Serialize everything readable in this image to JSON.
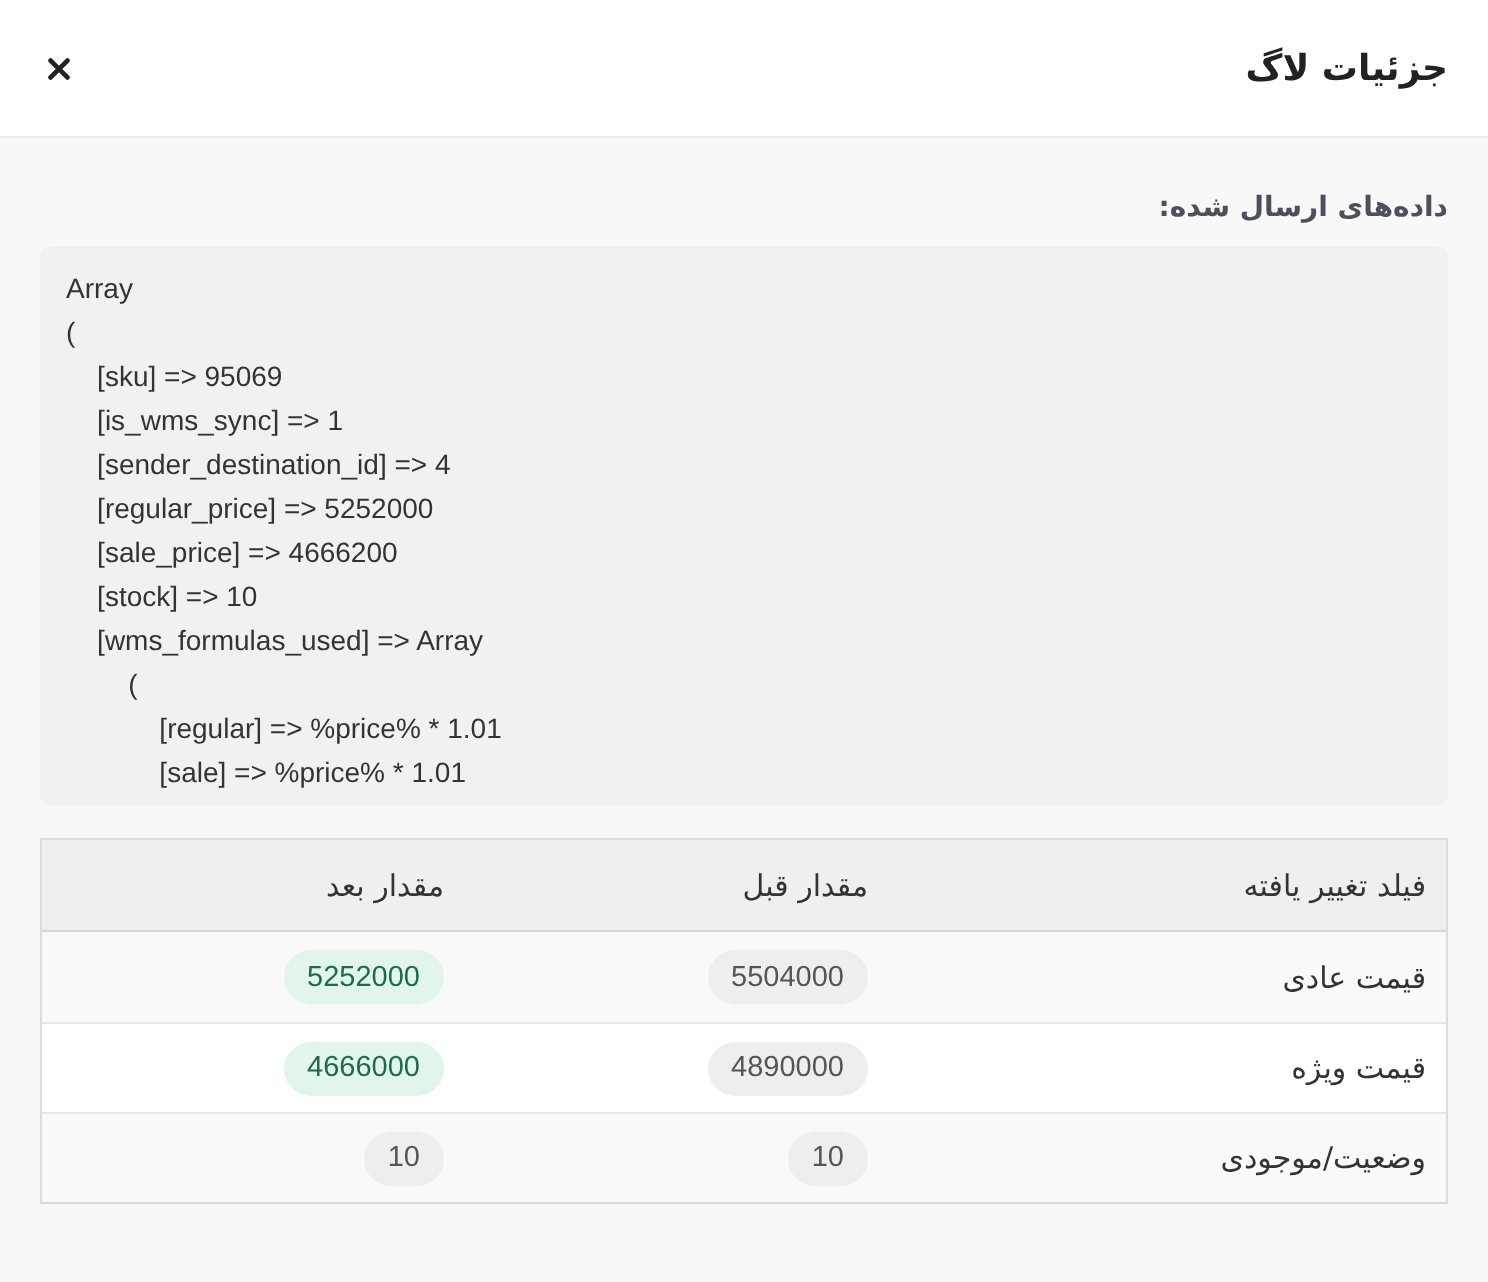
{
  "dialog": {
    "title": "جزئیات لاگ"
  },
  "sent_data": {
    "label": "داده‌های ارسال شده:",
    "text": "Array\n(\n    [sku] => 95069\n    [is_wms_sync] => 1\n    [sender_destination_id] => 4\n    [regular_price] => 5252000\n    [sale_price] => 4666200\n    [stock] => 10\n    [wms_formulas_used] => Array\n        (\n            [regular] => %price% * 1.01\n            [sale] => %price% * 1.01"
  },
  "changes_table": {
    "columns": [
      "فیلد تغییر یافته",
      "مقدار قبل",
      "مقدار بعد"
    ],
    "rows": [
      {
        "field": "قیمت عادی",
        "before": "5504000",
        "after": "5252000",
        "changed": true
      },
      {
        "field": "قیمت ویژه",
        "before": "4890000",
        "after": "4666000",
        "changed": true
      },
      {
        "field": "وضعیت/موجودی",
        "before": "10",
        "after": "10",
        "changed": false
      }
    ]
  }
}
